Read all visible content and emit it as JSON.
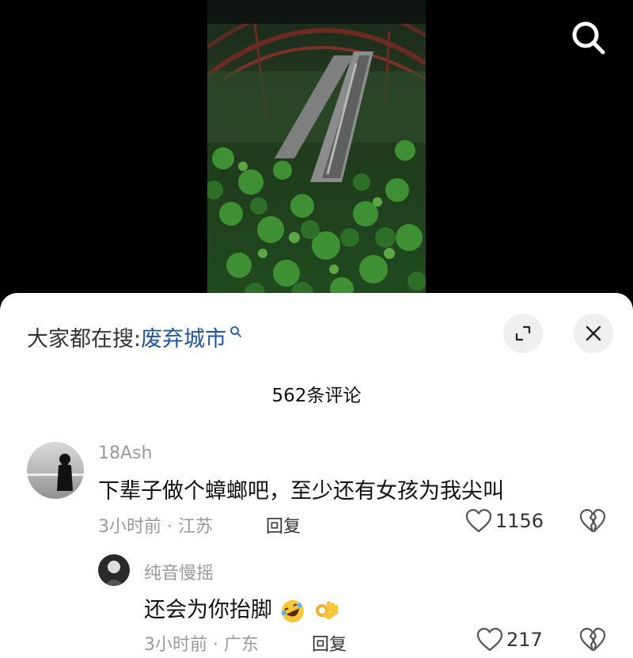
{
  "hot_search": {
    "prefix": "大家都在搜:",
    "keyword": "废弃城市"
  },
  "comment_count": "562条评论",
  "comments": [
    {
      "user": "18Ash",
      "text": "下辈子做个蟑螂吧，至少还有女孩为我尖叫",
      "meta": "3小时前 · 江苏",
      "reply_label": "回复",
      "likes": "1156"
    }
  ],
  "replies": [
    {
      "user": "纯音慢摇",
      "text": "还会为你抬脚",
      "emojis": [
        "rofl-emoji",
        "ok-hand-emoji"
      ],
      "meta": "3小时前 · 广东",
      "reply_label": "回复",
      "likes": "217"
    }
  ],
  "icons": [
    "search-icon",
    "magnifier-icon",
    "expand-icon",
    "close-icon",
    "heart-icon",
    "broken-heart-icon"
  ],
  "colors": {
    "keyword": "#1f55a6",
    "secondary_text": "#9a9a9a",
    "sheet_bg": "#ffffff"
  }
}
